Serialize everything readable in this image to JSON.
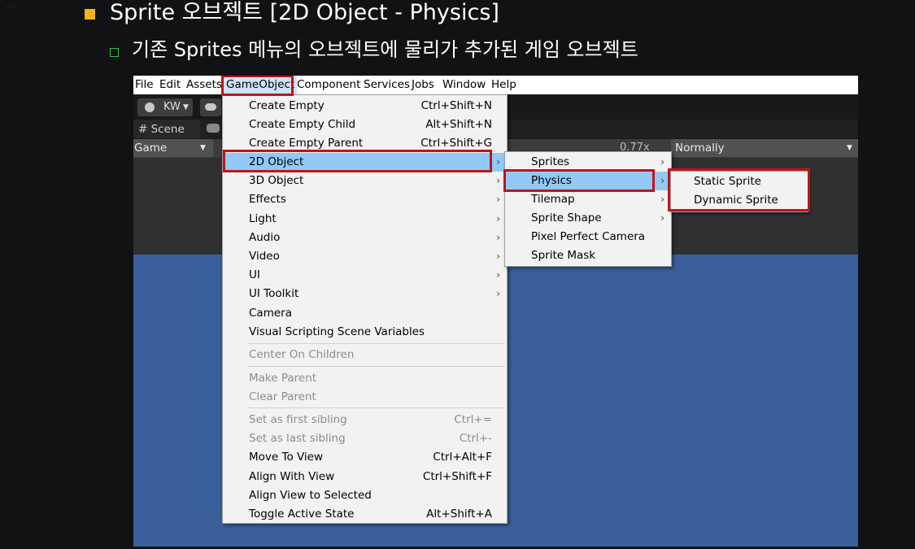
{
  "slide": {
    "title": "Sprite 오브젝트 [2D Object - Physics]",
    "subtitle": "기존 Sprites 메뉴의 오브젝트에 물리가 추가된 게임 오브젝트"
  },
  "menubar": [
    "File",
    "Edit",
    "Assets",
    "GameObject",
    "Component",
    "Services",
    "Jobs",
    "Window",
    "Help"
  ],
  "toolbar": {
    "account": "KW"
  },
  "tabs": {
    "scene": "# Scene"
  },
  "game_view": {
    "display": "Game",
    "scale": "0.77x",
    "mode": "Normally"
  },
  "gameobject_menu": [
    {
      "label": "Create Empty",
      "shortcut": "Ctrl+Shift+N"
    },
    {
      "label": "Create Empty Child",
      "shortcut": "Alt+Shift+N"
    },
    {
      "label": "Create Empty Parent",
      "shortcut": "Ctrl+Shift+G"
    },
    {
      "label": "2D Object",
      "submenu": true,
      "highlighted": true
    },
    {
      "label": "3D Object",
      "submenu": true
    },
    {
      "label": "Effects",
      "submenu": true
    },
    {
      "label": "Light",
      "submenu": true
    },
    {
      "label": "Audio",
      "submenu": true
    },
    {
      "label": "Video",
      "submenu": true
    },
    {
      "label": "UI",
      "submenu": true
    },
    {
      "label": "UI Toolkit",
      "submenu": true
    },
    {
      "label": "Camera"
    },
    {
      "label": "Visual Scripting Scene Variables"
    },
    {
      "label": "Center On Children",
      "disabled": true
    },
    {
      "label": "Make Parent",
      "disabled": true
    },
    {
      "label": "Clear Parent",
      "disabled": true
    },
    {
      "label": "Set as first sibling",
      "shortcut": "Ctrl+=",
      "disabled": true
    },
    {
      "label": "Set as last sibling",
      "shortcut": "Ctrl+-",
      "disabled": true
    },
    {
      "label": "Move To View",
      "shortcut": "Ctrl+Alt+F"
    },
    {
      "label": "Align With View",
      "shortcut": "Ctrl+Shift+F"
    },
    {
      "label": "Align View to Selected"
    },
    {
      "label": "Toggle Active State",
      "shortcut": "Alt+Shift+A"
    }
  ],
  "object2d_menu": [
    {
      "label": "Sprites",
      "submenu": true
    },
    {
      "label": "Physics",
      "submenu": true,
      "highlighted": true
    },
    {
      "label": "Tilemap",
      "submenu": true
    },
    {
      "label": "Sprite Shape",
      "submenu": true
    },
    {
      "label": "Pixel Perfect Camera"
    },
    {
      "label": "Sprite Mask"
    }
  ],
  "physics_menu": [
    {
      "label": "Static Sprite"
    },
    {
      "label": "Dynamic Sprite"
    }
  ],
  "colors": {
    "bullet_primary": "#f2b31a",
    "bullet_secondary": "#33c24d",
    "highlight_box": "#c0141b",
    "menu_highlight": "#91c9f7",
    "game_view_blue": "#3a5f9b"
  }
}
